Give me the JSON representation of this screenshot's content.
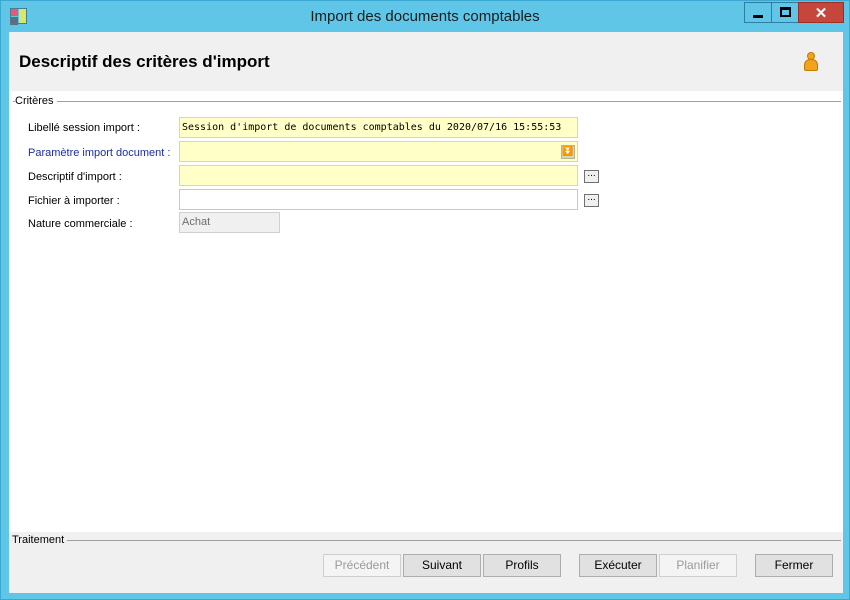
{
  "window": {
    "title": "Import des documents comptables",
    "minimize_label": "minimize",
    "maximize_label": "maximize",
    "close_label": "✕"
  },
  "header": {
    "title": "Descriptif des critères d'import",
    "user_icon": "user-icon"
  },
  "criteria": {
    "group_label": "Critères",
    "fields": [
      {
        "label": "Libellé session import :",
        "value": "Session d'import de documents comptables du 2020/07/16 15:55:53"
      },
      {
        "label": "Paramètre import document :",
        "value": ""
      },
      {
        "label": "Descriptif d'import :",
        "value": ""
      },
      {
        "label": "Fichier à importer :",
        "value": ""
      },
      {
        "label": "Nature commerciale :",
        "value": "Achat"
      }
    ],
    "browse_label": "..."
  },
  "treatment": {
    "group_label": "Traitement",
    "buttons": {
      "previous": "Précédent",
      "next": "Suivant",
      "profiles": "Profils",
      "execute": "Exécuter",
      "schedule": "Planifier",
      "close": "Fermer"
    }
  },
  "colors": {
    "title_bar": "#5fc6e8",
    "required_field": "#ffffc8",
    "link_label": "#1a2ea5",
    "close_button": "#c7463c"
  }
}
